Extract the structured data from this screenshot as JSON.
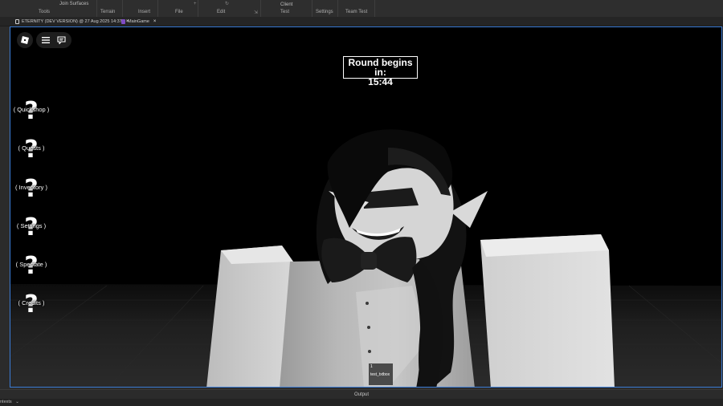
{
  "ribbon": {
    "join_surfaces": "Join Surfaces",
    "client_label": "Client",
    "group_labels": [
      "Tools",
      "Terrain",
      "Insert",
      "File",
      "Edit",
      "Test",
      "Settings",
      "Team Test"
    ]
  },
  "tabs": [
    {
      "label": "ETERNITY (DEV VERSION) @ 27 Aug 2025 14:37",
      "close": "×"
    },
    {
      "label": "MainGame",
      "close": "×"
    }
  ],
  "game": {
    "timer_line1": "Round begins in:",
    "timer_line2": "15:44",
    "side_menu": [
      {
        "label": "( Quickshop )",
        "icon": "question-mark"
      },
      {
        "label": "( Quests )",
        "icon": "question-mark"
      },
      {
        "label": "( Inventory )",
        "icon": "question-mark"
      },
      {
        "label": "( Settings )",
        "icon": "question-mark"
      },
      {
        "label": "( Spectate )",
        "icon": "question-mark"
      },
      {
        "label": "( Credits )",
        "icon": "question-mark"
      }
    ],
    "test_textbox": {
      "number": "1",
      "name": "test_txtbox"
    }
  },
  "panels": {
    "output_label": "Output",
    "bottom_left": "ntexts"
  },
  "colors": {
    "viewport_border": "#3a7bd5",
    "studio_bg": "#2b2b2b",
    "script_tab_icon": "#7f4cc6"
  }
}
